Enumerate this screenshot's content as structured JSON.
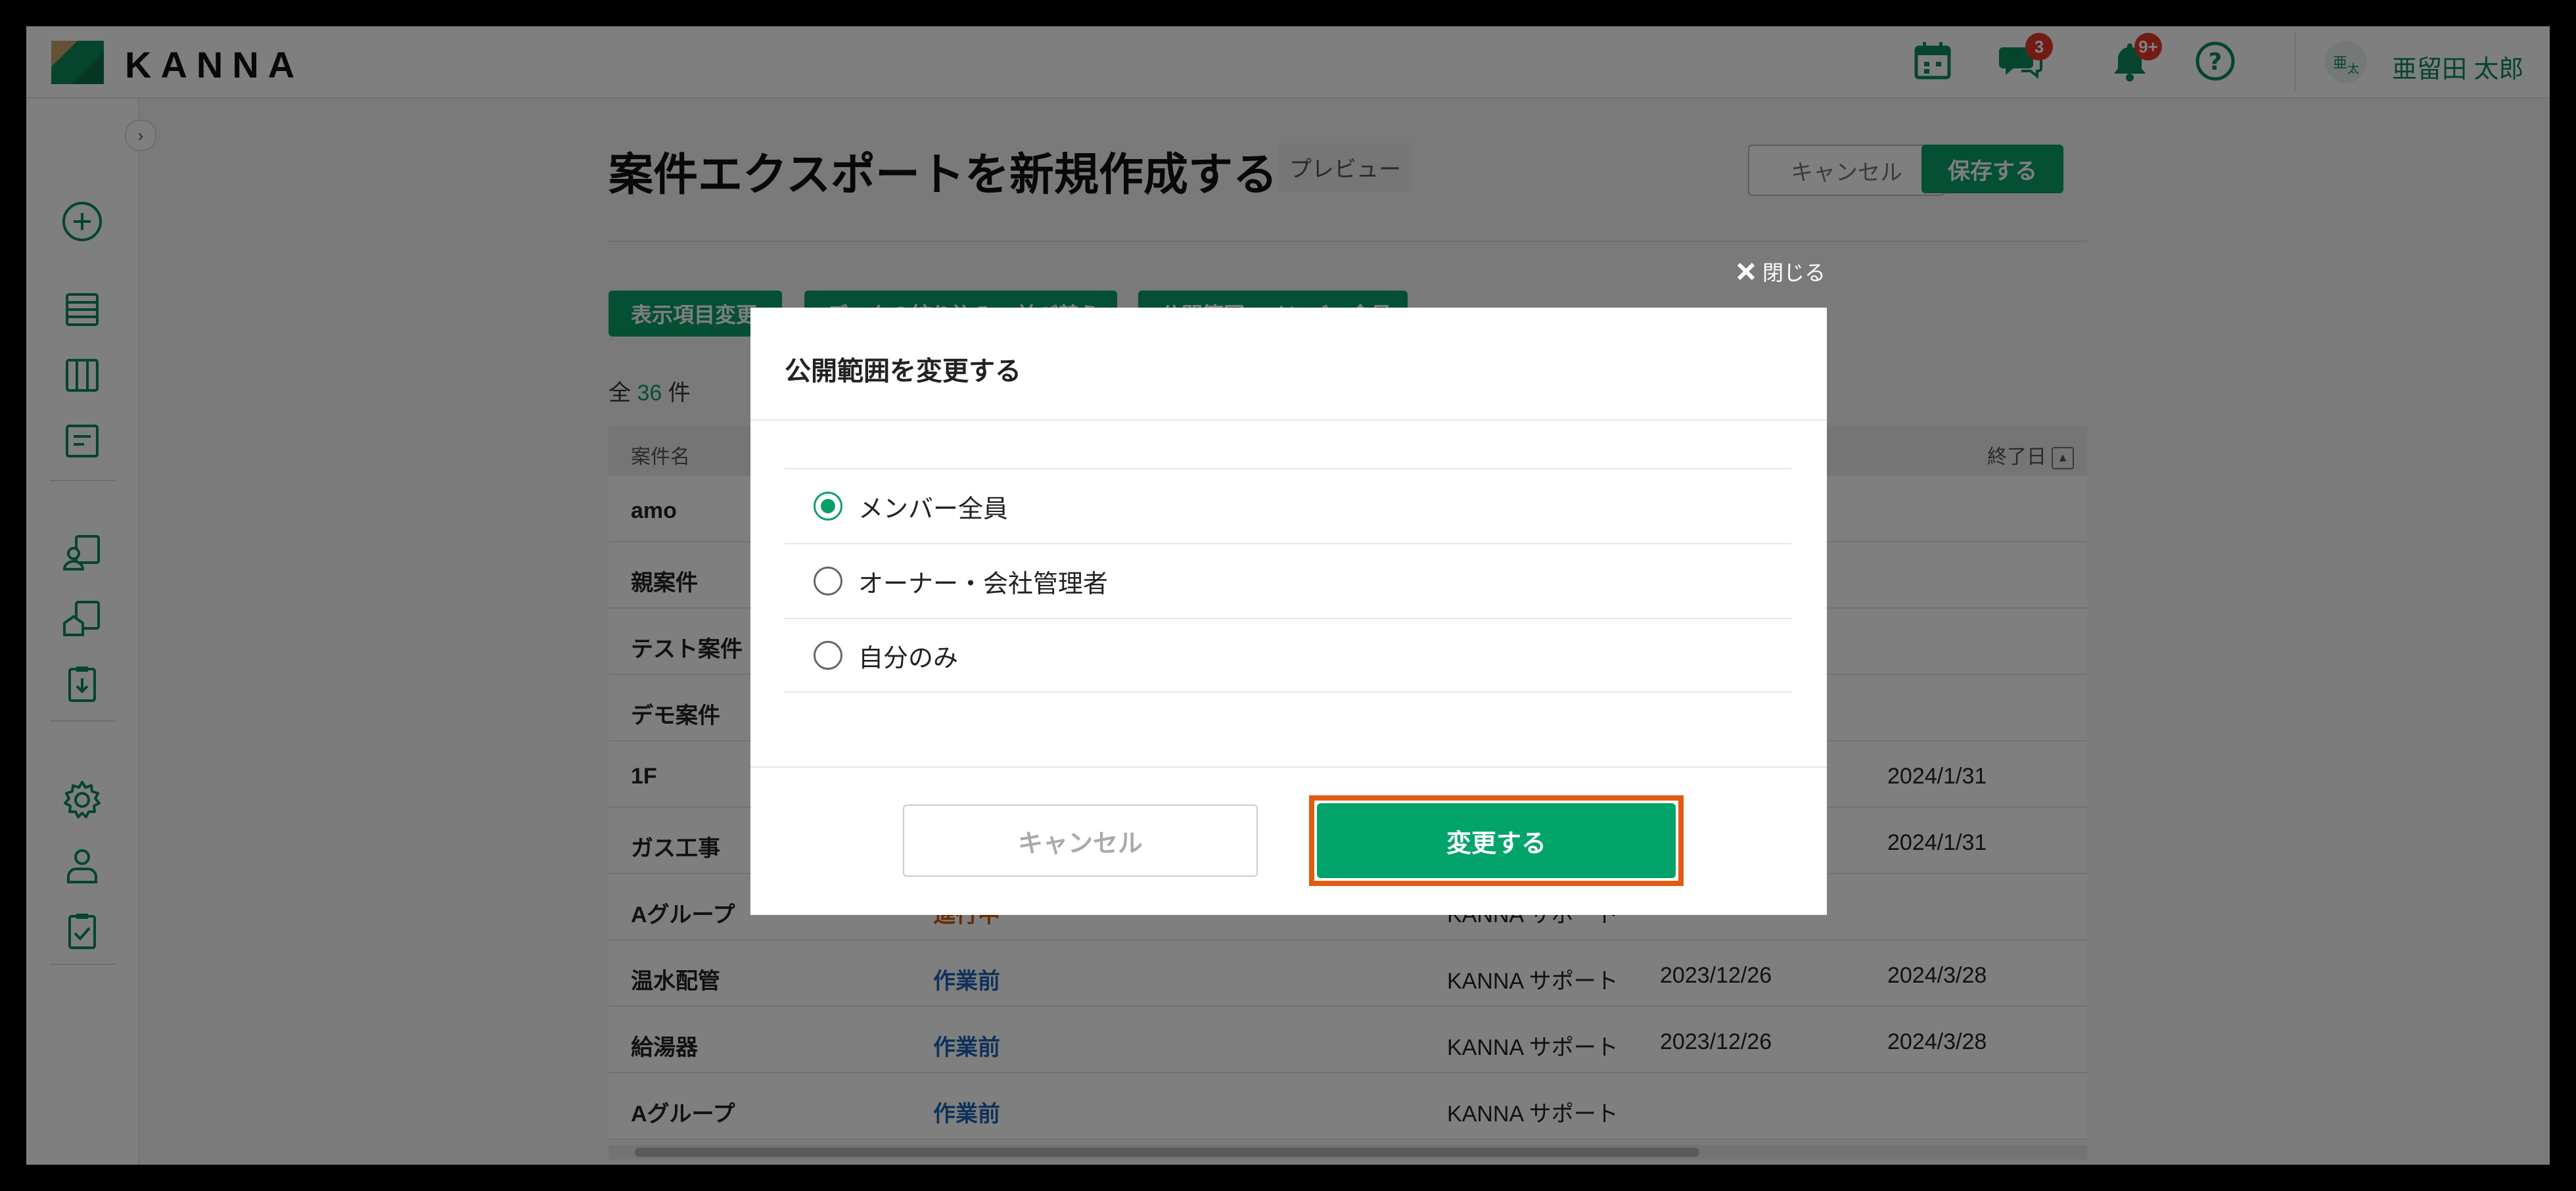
{
  "header": {
    "logo_text": "KANNA",
    "chat_badge": "3",
    "notification_badge": "9+",
    "avatar_text_top": "亜",
    "avatar_text_bottom": "太",
    "user_name": "亜留田 太郎"
  },
  "page": {
    "title": "案件エクスポートを新規作成する",
    "preview_label": "プレビュー",
    "cancel_label": "キャンセル",
    "save_label": "保存する",
    "toolbar": [
      "表示項目変更",
      "データの絞り込み・並び替え",
      "公開範囲：メンバー全員"
    ],
    "count_prefix": "全",
    "count_value": "36",
    "count_suffix": "件"
  },
  "table": {
    "headers": {
      "name": "案件名",
      "end": "終了日"
    },
    "rows": [
      {
        "name": "amo",
        "status": "",
        "manager": "",
        "start": "",
        "end": ""
      },
      {
        "name": "親案件",
        "status": "",
        "manager": "",
        "start": "",
        "end": ""
      },
      {
        "name": "テスト案件",
        "status": "",
        "manager": "",
        "start": "",
        "end": ""
      },
      {
        "name": "デモ案件",
        "status": "",
        "manager": "",
        "start": "",
        "end": ""
      },
      {
        "name": "1F",
        "status": "",
        "manager": "",
        "start": "",
        "end": "2024/1/31"
      },
      {
        "name": "ガス工事",
        "status": "",
        "manager": "",
        "start": "",
        "end": "2024/1/31"
      },
      {
        "name": "Aグループ",
        "status": "進行中",
        "manager": "KANNA サポート",
        "start": "",
        "end": ""
      },
      {
        "name": "温水配管",
        "status": "作業前",
        "manager": "KANNA サポート",
        "start": "2023/12/26",
        "end": "2024/3/28"
      },
      {
        "name": "給湯器",
        "status": "作業前",
        "manager": "KANNA サポート",
        "start": "2023/12/26",
        "end": "2024/3/28"
      },
      {
        "name": "Aグループ",
        "status": "作業前",
        "manager": "KANNA サポート",
        "start": "",
        "end": ""
      }
    ]
  },
  "modal": {
    "close_label": "閉じる",
    "title": "公開範囲を変更する",
    "options": [
      {
        "label": "メンバー全員",
        "selected": true
      },
      {
        "label": "オーナー・会社管理者",
        "selected": false
      },
      {
        "label": "自分のみ",
        "selected": false
      }
    ],
    "cancel_label": "キャンセル",
    "submit_label": "変更する"
  },
  "colors": {
    "brand_green": "#0a9f68",
    "highlight_orange": "#e35a12",
    "status_in_progress": "#d35400",
    "status_before_work": "#1f62b4"
  }
}
